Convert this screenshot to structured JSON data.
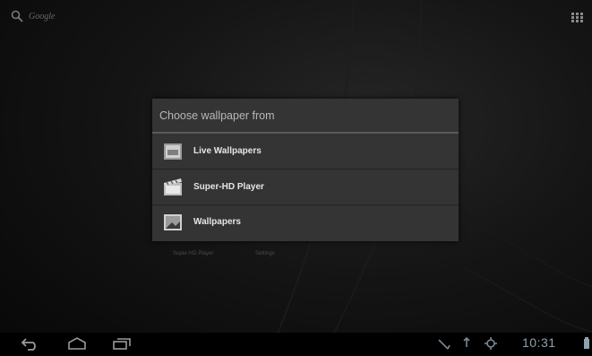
{
  "search": {
    "label": "Google",
    "icon": "search-icon"
  },
  "apps_button": {
    "icon": "apps-grid-icon"
  },
  "dialog": {
    "title": "Choose wallpaper from",
    "options": [
      {
        "label": "Live Wallpapers",
        "icon": "live-wallpapers-icon"
      },
      {
        "label": "Super-HD Player",
        "icon": "super-hd-player-icon"
      },
      {
        "label": "Wallpapers",
        "icon": "wallpapers-icon"
      }
    ]
  },
  "background_labels": [
    "Super-HD Player",
    "Settings"
  ],
  "navbar": {
    "buttons": [
      "back-icon",
      "home-icon",
      "recent-apps-icon"
    ],
    "status_icons": [
      "usb-icon",
      "notification-icon",
      "signal-icon",
      "battery-icon"
    ],
    "clock": "10:31"
  },
  "colors": {
    "dialog_bg": "#343434",
    "divider": "#5a5a5a",
    "clock": "#8fa1ad"
  }
}
